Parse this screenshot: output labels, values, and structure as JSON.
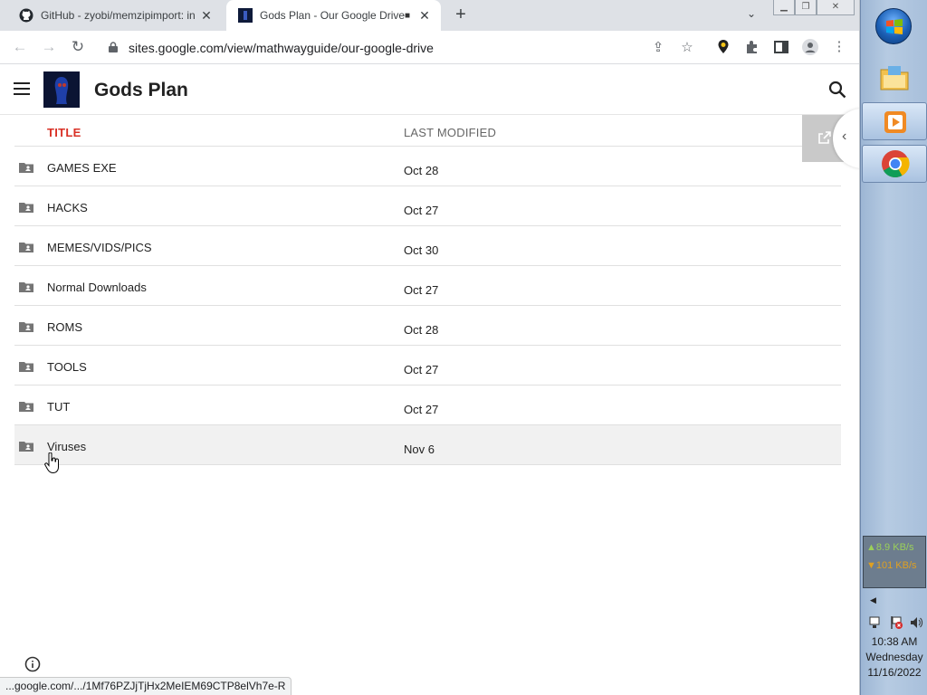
{
  "browser": {
    "tabs": [
      {
        "title": "GitHub - zyobi/memzipimport: in",
        "icon": "github-icon",
        "active": false
      },
      {
        "title": "Gods Plan - Our Google Drive",
        "icon": "site-favicon",
        "active": true
      }
    ],
    "new_tab_label": "+",
    "url": "sites.google.com/view/mathwayguide/our-google-drive",
    "status_url": "...google.com/.../1Mf76PZJjTjHx2MeIEM69CTP8elVh7e-R"
  },
  "site": {
    "title": "Gods Plan",
    "table": {
      "headers": {
        "title": "TITLE",
        "modified": "LAST MODIFIED"
      },
      "rows": [
        {
          "name": "GAMES EXE",
          "modified": "Oct 28"
        },
        {
          "name": "HACKS",
          "modified": "Oct 27"
        },
        {
          "name": "MEMES/VIDS/PICS",
          "modified": "Oct 30"
        },
        {
          "name": "Normal Downloads",
          "modified": "Oct 27"
        },
        {
          "name": "ROMS",
          "modified": "Oct 28"
        },
        {
          "name": "TOOLS",
          "modified": "Oct 27"
        },
        {
          "name": "TUT",
          "modified": "Oct 27"
        },
        {
          "name": "Viruses",
          "modified": "Nov 6"
        }
      ],
      "hovered_row": "Viruses"
    }
  },
  "taskbar": {
    "net_up": "▲8.9 KB/s",
    "net_down": "▼101 KB/s",
    "time": "10:38 AM",
    "day": "Wednesday",
    "date": "11/16/2022",
    "pinned": [
      "explorer-icon",
      "media-player-icon",
      "chrome-icon"
    ]
  },
  "colors": {
    "accent_red": "#d93025",
    "tabstrip": "#dee1e6",
    "taskbar": "#b6cbe2"
  }
}
